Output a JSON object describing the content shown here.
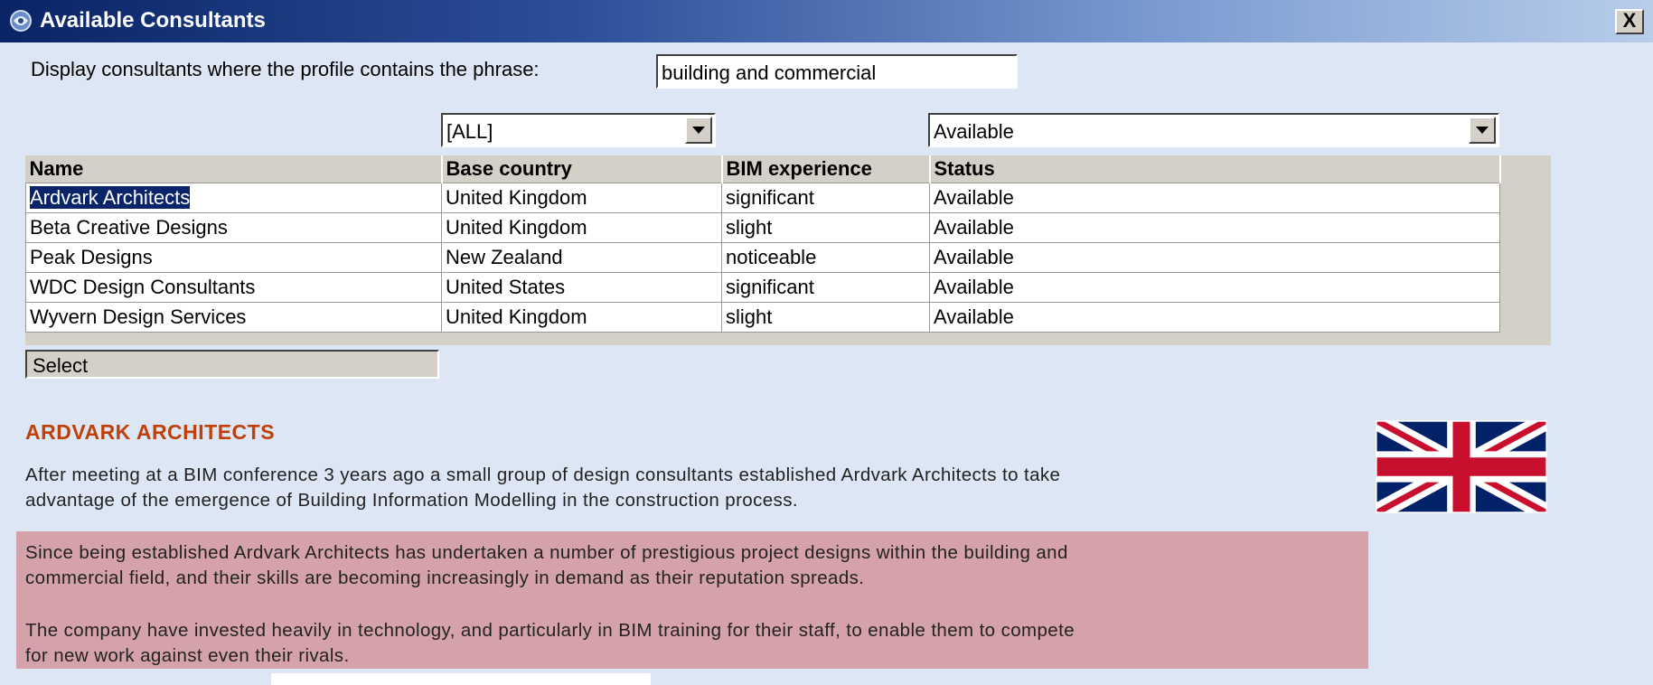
{
  "window": {
    "title": "Available Consultants",
    "close_label": "X"
  },
  "filter": {
    "label": "Display consultants where the profile contains the phrase:",
    "value": "building and commercial",
    "country_dropdown": "[ALL]",
    "status_dropdown": "Available"
  },
  "grid": {
    "columns": [
      "Name",
      "Base country",
      "BIM experience",
      "Status"
    ],
    "rows": [
      {
        "name": "Ardvark Architects",
        "country": "United Kingdom",
        "bim": "significant",
        "status": "Available"
      },
      {
        "name": "Beta Creative Designs",
        "country": "United Kingdom",
        "bim": "slight",
        "status": "Available"
      },
      {
        "name": "Peak Designs",
        "country": "New Zealand",
        "bim": "noticeable",
        "status": "Available"
      },
      {
        "name": "WDC Design Consultants",
        "country": "United States",
        "bim": "significant",
        "status": "Available"
      },
      {
        "name": "Wyvern Design Services",
        "country": "United Kingdom",
        "bim": "slight",
        "status": "Available"
      }
    ],
    "selected_row": 0
  },
  "select_button": "Select",
  "detail": {
    "title": "ARDVARK ARCHITECTS",
    "para1_line1": "After meeting at a BIM conference 3 years ago a small group of design consultants established Ardvark Architects to take",
    "para1_line2": "advantage of the emergence of Building Information Modelling in the construction process.",
    "para2_line1": "Since being established Ardvark Architects has undertaken a number of prestigious project designs within the building and",
    "para2_line2": "commercial field, and their skills are becoming increasingly in demand as their reputation spreads.",
    "para3_line1": "The company have invested heavily in technology, and particularly in BIM training for their staff, to enable them to compete",
    "para3_line2": "for new work against even their rivals.",
    "flag_icon": "uk-flag-icon"
  },
  "colors": {
    "title_bar_start": "#0a2466",
    "window_bg": "#dce6f4",
    "highlight": "#d6a2a9",
    "detail_title": "#c0400a",
    "selection": "#0a246a"
  }
}
